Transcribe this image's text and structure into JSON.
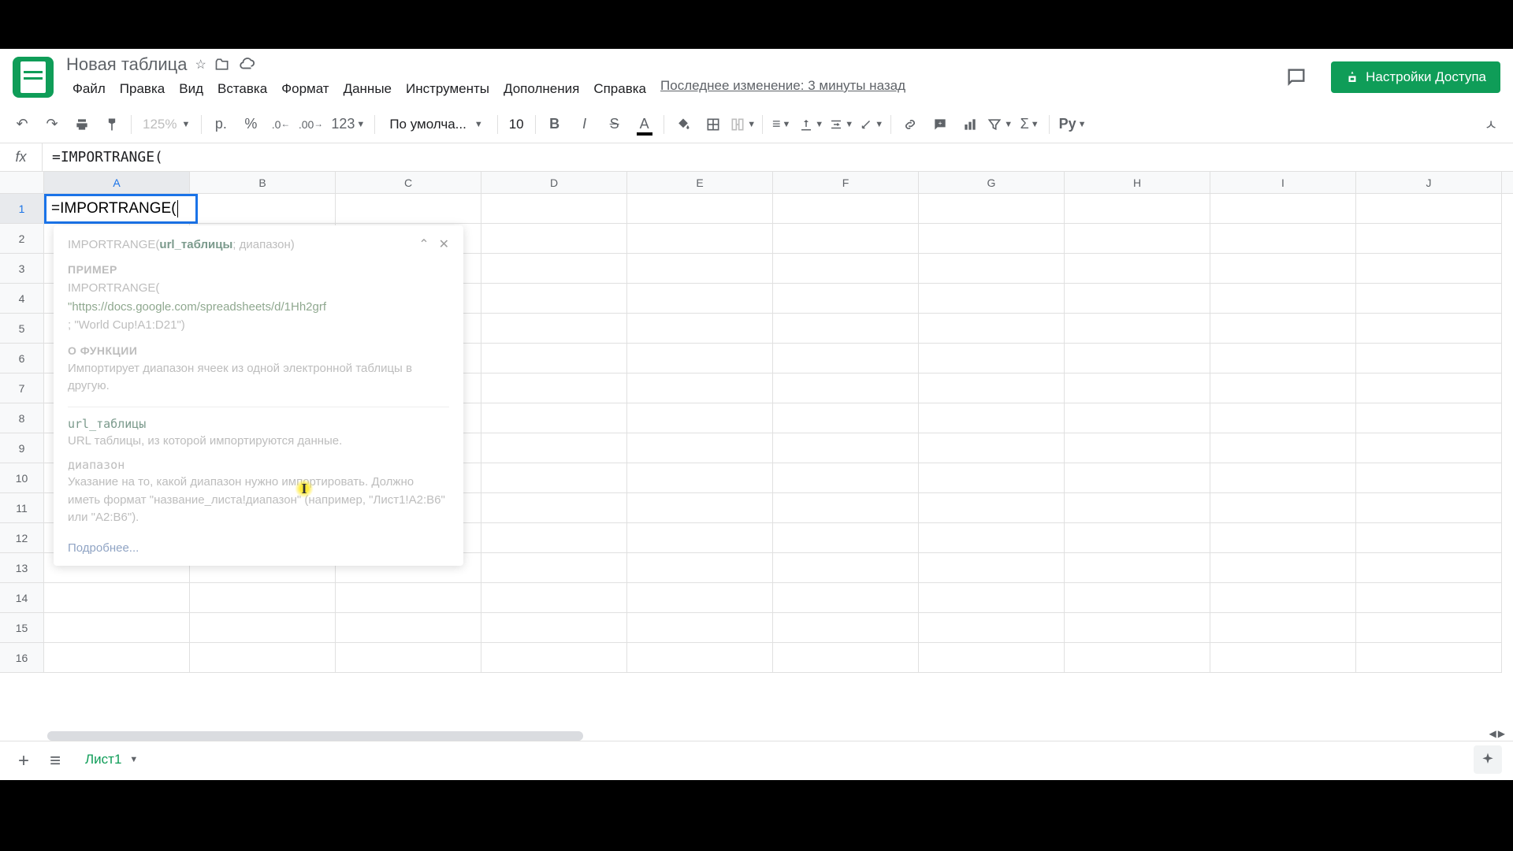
{
  "doc": {
    "title": "Новая таблица"
  },
  "menubar": {
    "file": "Файл",
    "edit": "Правка",
    "view": "Вид",
    "insert": "Вставка",
    "format": "Формат",
    "data": "Данные",
    "tools": "Инструменты",
    "addons": "Дополнения",
    "help": "Справка",
    "last_edit": "Последнее изменение: 3 минуты назад"
  },
  "share": {
    "label": "Настройки Доступа"
  },
  "toolbar": {
    "zoom": "125%",
    "currency": "р.",
    "percent": "%",
    "dec_dec": ".0",
    "inc_dec": ".00",
    "num_format": "123",
    "font": "По умолча...",
    "font_size": "10",
    "input_tools": "Ру"
  },
  "formula": {
    "value": "=IMPORTRANGE("
  },
  "columns": [
    "A",
    "B",
    "C",
    "D",
    "E",
    "F",
    "G",
    "H",
    "I",
    "J"
  ],
  "rows": [
    "1",
    "2",
    "3",
    "4",
    "5",
    "6",
    "7",
    "8",
    "9",
    "10",
    "11",
    "12",
    "13",
    "14",
    "15",
    "16"
  ],
  "cell": {
    "value": "=IMPORTRANGE("
  },
  "tooltip": {
    "fn": "IMPORTRANGE(",
    "arg1": "url_таблицы",
    "sep": "; ",
    "arg2": "диапазон",
    "close": ")",
    "example_title": "ПРИМЕР",
    "example_fn": "IMPORTRANGE(",
    "example_url": "\"https://docs.google.com/spreadsheets/d/1Hh2grf",
    "example_rest": "; \"World Cup!A1:D21\")",
    "about_title": "О ФУНКЦИИ",
    "about_desc": "Импортирует диапазон ячеек из одной электронной таблицы в другую.",
    "param1_name": "url_таблицы",
    "param1_desc": "URL таблицы, из которой импортируются данные.",
    "param2_name": "диапазон",
    "param2_desc": "Указание на то, какой диапазон нужно импортировать. Должно иметь формат \"название_листа!диапазон\" (например, \"Лист1!A2:B6\" или \"A2:B6\").",
    "more": "Подробнее..."
  },
  "sheet": {
    "name": "Лист1"
  }
}
